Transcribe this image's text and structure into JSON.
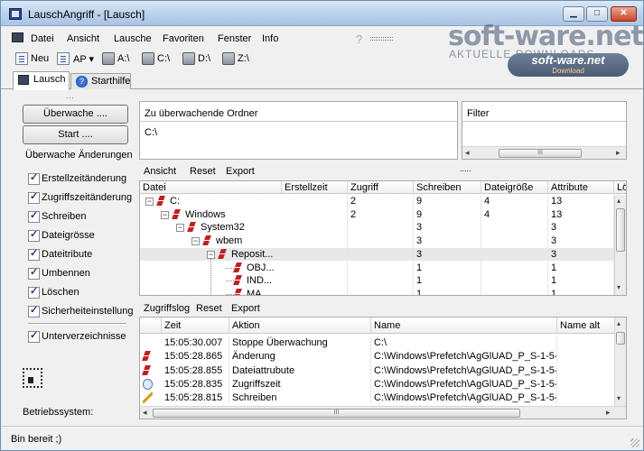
{
  "window": {
    "title": "LauschAngriff - [Lausch]",
    "controls": {
      "minimize": "▁",
      "maximize": "□",
      "close": "✕"
    }
  },
  "watermark": {
    "logo": "soft-ware.net",
    "subtitle": "AKTUELLE DOWNLOADS",
    "badge_title": "soft-ware.net",
    "badge_sub": "Download"
  },
  "menubar": {
    "items": [
      "Datei",
      "Ansicht",
      "Lausche",
      "Favoriten",
      "Fenster",
      "Info"
    ],
    "help": "?"
  },
  "toolbar": {
    "new_label": "Neu",
    "ap_label": "AP ▾",
    "drives": [
      "A:\\",
      "C:\\",
      "D:\\",
      "Z:\\"
    ]
  },
  "tabs": [
    {
      "label": "Lausch",
      "active": true
    },
    {
      "label": "Starthilfe",
      "active": false
    }
  ],
  "left": {
    "dots": "...",
    "watch_button": "Überwache ....",
    "start_button": "Start ....",
    "group_label": "Überwache Änderungen",
    "checkboxes": [
      "Erstellzeitänderung",
      "Zugriffszeitänderung",
      "Schreiben",
      "Dateigrösse",
      "Dateitribute",
      "Umbennen",
      "Löschen",
      "Sicherheiteinstellung"
    ],
    "subdir_checkbox": "Unterverzeichnisse",
    "os_label": "Betriebssystem:"
  },
  "watch": {
    "header": "Zu überwachende Ordner",
    "rows": [
      "C:\\"
    ]
  },
  "filter": {
    "header": "Filter"
  },
  "mid_toolbar": {
    "links": [
      "Ansicht",
      "Reset",
      "Export"
    ],
    "dots": "....."
  },
  "tree": {
    "columns": [
      "Datei",
      "Erstellzeit",
      "Zugriff",
      "Schreiben",
      "Dateigröße",
      "Attribute",
      "Lö"
    ],
    "rows": [
      {
        "level": 0,
        "exp": "−",
        "name": "C:",
        "erst": "",
        "zugriff": "2",
        "schreiben": "9",
        "groesse": "4",
        "attr": "13"
      },
      {
        "level": 1,
        "exp": "−",
        "name": "Windows",
        "erst": "",
        "zugriff": "2",
        "schreiben": "9",
        "groesse": "4",
        "attr": "13"
      },
      {
        "level": 2,
        "exp": "−",
        "name": "System32",
        "erst": "",
        "zugriff": "",
        "schreiben": "3",
        "groesse": "",
        "attr": "3"
      },
      {
        "level": 3,
        "exp": "−",
        "name": "wbem",
        "erst": "",
        "zugriff": "",
        "schreiben": "3",
        "groesse": "",
        "attr": "3"
      },
      {
        "level": 4,
        "exp": "−",
        "name": "Reposit...",
        "erst": "",
        "zugriff": "",
        "schreiben": "3",
        "groesse": "",
        "attr": "3"
      },
      {
        "level": 5,
        "exp": "",
        "name": "OBJ...",
        "erst": "",
        "zugriff": "",
        "schreiben": "1",
        "groesse": "",
        "attr": "1"
      },
      {
        "level": 5,
        "exp": "",
        "name": "IND...",
        "erst": "",
        "zugriff": "",
        "schreiben": "1",
        "groesse": "",
        "attr": "1"
      },
      {
        "level": 5,
        "exp": "",
        "name": "MA...",
        "erst": "",
        "zugriff": "",
        "schreiben": "1",
        "groesse": "",
        "attr": "1"
      }
    ]
  },
  "log_toolbar": {
    "links": [
      "Zugriffslog",
      "Reset",
      "Export"
    ]
  },
  "log": {
    "columns": [
      "",
      "Zeit",
      "Aktion",
      "Name",
      "Name alt"
    ],
    "rows": [
      {
        "icon": "none",
        "zeit": "15:05:30.007",
        "aktion": "Stoppe Überwachung",
        "name": "C:\\"
      },
      {
        "icon": "ch",
        "zeit": "15:05:28.865",
        "aktion": "Änderung",
        "name": "C:\\Windows\\Prefetch\\AgGlUAD_P_S-1-5-..."
      },
      {
        "icon": "at",
        "zeit": "15:05:28.855",
        "aktion": "Dateiattrubute",
        "name": "C:\\Windows\\Prefetch\\AgGlUAD_P_S-1-5-..."
      },
      {
        "icon": "zz",
        "zeit": "15:05:28.835",
        "aktion": "Zugriffszeit",
        "name": "C:\\Windows\\Prefetch\\AgGlUAD_P_S-1-5-..."
      },
      {
        "icon": "sc",
        "zeit": "15:05:28.815",
        "aktion": "Schreiben",
        "name": "C:\\Windows\\Prefetch\\AgGlUAD_P_S-1-5-..."
      }
    ]
  },
  "scroll": {
    "thumb": "III"
  },
  "status": {
    "text": "Bin bereit ;)"
  }
}
